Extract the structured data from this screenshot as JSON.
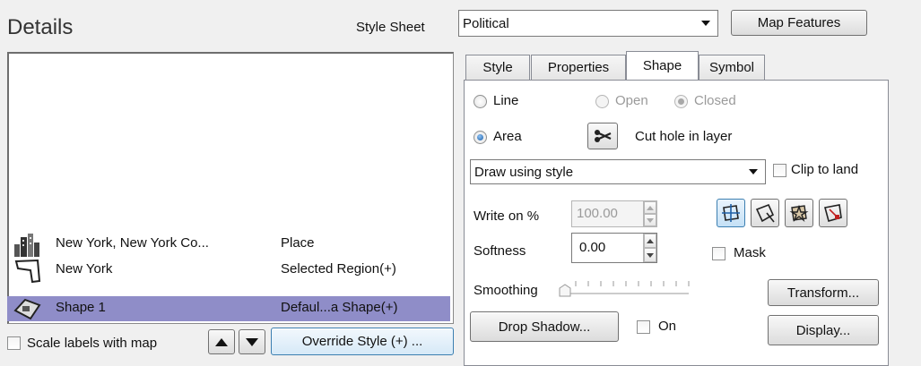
{
  "details": {
    "title": "Details",
    "style_sheet_label": "Style Sheet",
    "style_sheet_value": "Political",
    "map_features_label": "Map Features",
    "list": [
      {
        "name": "New York, New York Co...",
        "type": "Place",
        "icon": "city-buildings-icon",
        "selected": false
      },
      {
        "name": "New York",
        "type": "Selected Region(+)",
        "icon": "region-shape-icon",
        "selected": false
      },
      {
        "name": "Shape 1",
        "type": "Defaul...a Shape(+)",
        "icon": "shape-diamond-icon",
        "selected": true
      }
    ],
    "scale_labels_label": "Scale labels with map",
    "override_style_label": "Override Style (+) ..."
  },
  "tabs": [
    {
      "label": "Style",
      "active": false
    },
    {
      "label": "Properties",
      "active": false
    },
    {
      "label": "Shape",
      "active": true
    },
    {
      "label": "Symbol",
      "active": false
    }
  ],
  "shape_panel": {
    "line_label": "Line",
    "open_label": "Open",
    "closed_label": "Closed",
    "area_label": "Area",
    "cut_hole_label": "Cut hole in layer",
    "draw_using_value": "Draw using style",
    "clip_to_land_label": "Clip to land",
    "write_on_label": "Write on %",
    "write_on_value": "100.00",
    "softness_label": "Softness",
    "softness_value": "0.00",
    "mask_label": "Mask",
    "smoothing_label": "Smoothing",
    "transform_label": "Transform...",
    "drop_shadow_label": "Drop Shadow...",
    "on_label": "On",
    "display_label": "Display..."
  },
  "colors": {
    "selection": "#8f8dc8",
    "background": "#f0f0f0"
  }
}
